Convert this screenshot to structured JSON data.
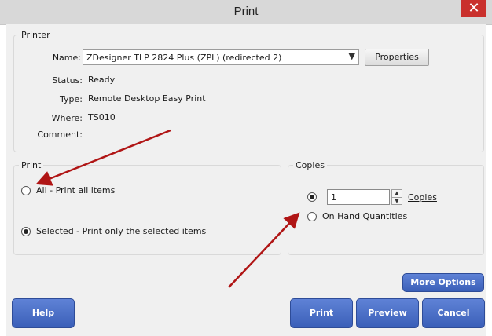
{
  "window": {
    "title": "Print",
    "close_glyph": "✕"
  },
  "printer": {
    "legend": "Printer",
    "name_label": "Name:",
    "name_value": "ZDesigner TLP 2824 Plus (ZPL) (redirected 2)",
    "properties_button": "Properties",
    "status_label": "Status:",
    "status_value": "Ready",
    "type_label": "Type:",
    "type_value": "Remote Desktop Easy Print",
    "where_label": "Where:",
    "where_value": "TS010",
    "comment_label": "Comment:"
  },
  "print_range": {
    "legend": "Print",
    "all_label": "All - Print all items",
    "selected_label": "Selected - Print only the selected items",
    "selected_option": "selected"
  },
  "copies": {
    "legend": "Copies",
    "value": "1",
    "copies_label": "Copies",
    "on_hand_label": "On Hand Quantities",
    "selected_option": "copies"
  },
  "buttons": {
    "more_options": "More Options",
    "help": "Help",
    "print": "Print",
    "preview": "Preview",
    "cancel": "Cancel"
  },
  "colors": {
    "annotation_arrow": "#b01515",
    "button_blue": "#4a6fc7"
  },
  "icons": {
    "dropdown": "chevron-down-icon",
    "spin_up": "arrow-up-icon",
    "spin_down": "arrow-down-icon",
    "close": "close-icon"
  }
}
